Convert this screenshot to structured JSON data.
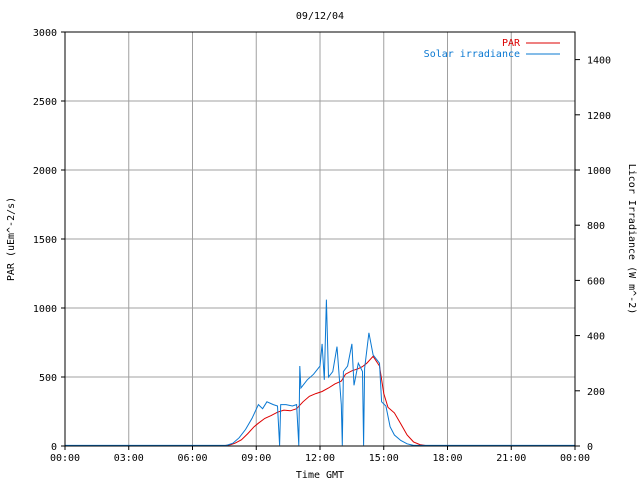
{
  "chart_data": {
    "type": "line",
    "title": "09/12/04",
    "xlabel": "Time GMT",
    "ylabel": "PAR (uEm^-2/s)",
    "y2label": "Licor Irradiance (W m^-2)",
    "x_ticks": [
      "00:00",
      "03:00",
      "06:00",
      "09:00",
      "12:00",
      "15:00",
      "18:00",
      "21:00",
      "00:00"
    ],
    "y_ticks": [
      "0",
      "500",
      "1000",
      "1500",
      "2000",
      "2500",
      "3000"
    ],
    "y2_ticks": [
      "0",
      "200",
      "400",
      "600",
      "800",
      "1000",
      "1200",
      "1400"
    ],
    "xlim_hours": [
      0,
      24
    ],
    "ylim": [
      0,
      3000
    ],
    "y2lim": [
      0,
      1500
    ],
    "grid": true,
    "legend_position": "top-right",
    "colors": {
      "par": "#dd0000",
      "solar": "#0a78d2",
      "grid": "#a0a0a0",
      "axes": "#000000"
    },
    "series": [
      {
        "name": "PAR",
        "axis": "left",
        "points": [
          [
            0,
            3
          ],
          [
            7.5,
            3
          ],
          [
            7.8,
            10
          ],
          [
            8.0,
            20
          ],
          [
            8.3,
            45
          ],
          [
            8.6,
            90
          ],
          [
            8.9,
            140
          ],
          [
            9.1,
            165
          ],
          [
            9.4,
            200
          ],
          [
            9.7,
            220
          ],
          [
            10.0,
            245
          ],
          [
            10.3,
            260
          ],
          [
            10.6,
            255
          ],
          [
            10.9,
            270
          ],
          [
            11.2,
            320
          ],
          [
            11.5,
            360
          ],
          [
            11.8,
            380
          ],
          [
            12.1,
            395
          ],
          [
            12.4,
            420
          ],
          [
            12.7,
            450
          ],
          [
            13.0,
            470
          ],
          [
            13.2,
            520
          ],
          [
            13.5,
            545
          ],
          [
            13.8,
            560
          ],
          [
            14.0,
            575
          ],
          [
            14.2,
            600
          ],
          [
            14.5,
            650
          ],
          [
            14.8,
            580
          ],
          [
            15.0,
            380
          ],
          [
            15.2,
            280
          ],
          [
            15.5,
            240
          ],
          [
            15.8,
            160
          ],
          [
            16.1,
            80
          ],
          [
            16.4,
            30
          ],
          [
            16.7,
            10
          ],
          [
            17.0,
            3
          ],
          [
            24,
            3
          ]
        ]
      },
      {
        "name": "Solar irradiance",
        "axis": "right",
        "points": [
          [
            0,
            2
          ],
          [
            7.6,
            2
          ],
          [
            7.9,
            10
          ],
          [
            8.2,
            30
          ],
          [
            8.5,
            60
          ],
          [
            8.8,
            100
          ],
          [
            9.1,
            150
          ],
          [
            9.3,
            135
          ],
          [
            9.5,
            160
          ],
          [
            9.8,
            150
          ],
          [
            10.0,
            145
          ],
          [
            10.1,
            2
          ],
          [
            10.15,
            150
          ],
          [
            10.4,
            150
          ],
          [
            10.7,
            145
          ],
          [
            10.9,
            150
          ],
          [
            11.0,
            2
          ],
          [
            11.05,
            290
          ],
          [
            11.1,
            210
          ],
          [
            11.4,
            240
          ],
          [
            11.7,
            260
          ],
          [
            12.0,
            290
          ],
          [
            12.1,
            370
          ],
          [
            12.2,
            240
          ],
          [
            12.3,
            530
          ],
          [
            12.4,
            250
          ],
          [
            12.6,
            270
          ],
          [
            12.8,
            360
          ],
          [
            13.0,
            150
          ],
          [
            13.05,
            2
          ],
          [
            13.1,
            270
          ],
          [
            13.3,
            290
          ],
          [
            13.5,
            370
          ],
          [
            13.6,
            220
          ],
          [
            13.8,
            300
          ],
          [
            14.0,
            270
          ],
          [
            14.05,
            2
          ],
          [
            14.1,
            280
          ],
          [
            14.3,
            410
          ],
          [
            14.5,
            330
          ],
          [
            14.8,
            300
          ],
          [
            14.9,
            160
          ],
          [
            15.1,
            145
          ],
          [
            15.3,
            70
          ],
          [
            15.5,
            40
          ],
          [
            15.8,
            20
          ],
          [
            16.1,
            8
          ],
          [
            16.4,
            2
          ],
          [
            24,
            2
          ]
        ]
      }
    ]
  }
}
